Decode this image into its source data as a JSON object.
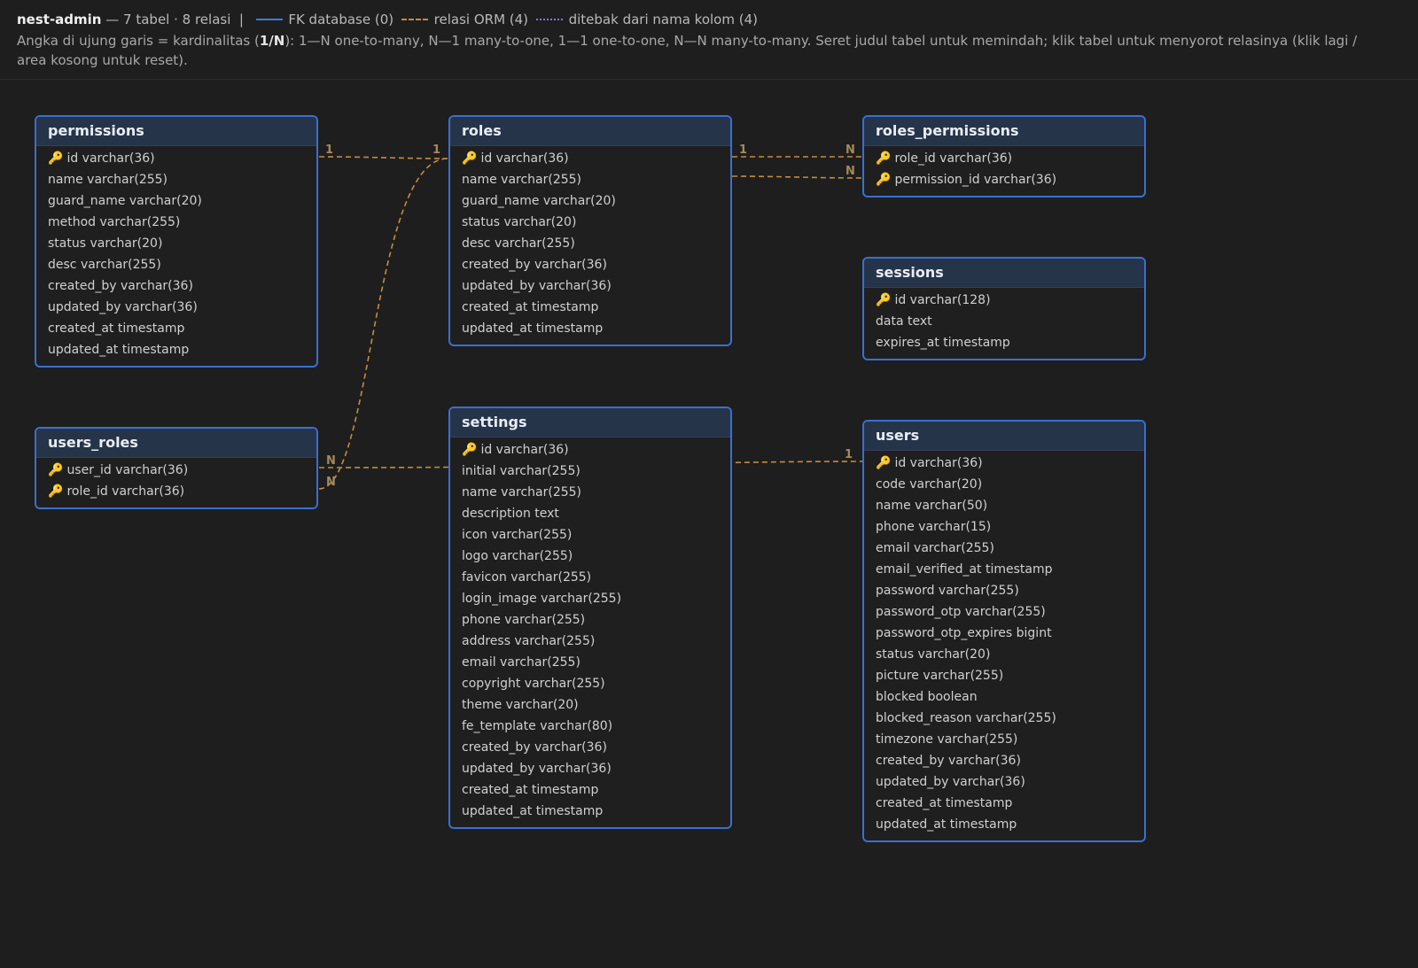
{
  "header": {
    "app_name": "nest-admin",
    "summary": " — 7 tabel · 8 relasi",
    "separator": "|",
    "legend": {
      "fk_label": "FK database (0)",
      "orm_label": "relasi ORM (4)",
      "guess_label": "ditebak dari nama kolom (4)"
    },
    "help_prefix": "Angka di ujung garis = kardinalitas (",
    "help_bold": "1/N",
    "help_suffix": "): 1—N one-to-many, N—1 many-to-one, 1—1 one-to-one, N—N many-to-many. Seret judul tabel untuk memindah; klik tabel untuk menyorot relasinya (klik lagi / area kosong untuk reset)."
  },
  "colors": {
    "background": "#1e1e1e",
    "table_border": "#3a6fd0",
    "table_header": "#263449",
    "fk_line": "#3b7be0",
    "orm_line": "#c78b3e",
    "guess_line": "#8a73e8",
    "key_icon": "#f2b51d"
  },
  "key_icon": "key-icon",
  "tables": [
    {
      "name": "permissions",
      "columns": [
        {
          "text": "id varchar(36)",
          "pk": true
        },
        {
          "text": "name varchar(255)"
        },
        {
          "text": "guard_name varchar(20)"
        },
        {
          "text": "method varchar(255)"
        },
        {
          "text": "status varchar(20)"
        },
        {
          "text": "desc varchar(255)"
        },
        {
          "text": "created_by varchar(36)"
        },
        {
          "text": "updated_by varchar(36)"
        },
        {
          "text": "created_at timestamp"
        },
        {
          "text": "updated_at timestamp"
        }
      ]
    },
    {
      "name": "roles",
      "columns": [
        {
          "text": "id varchar(36)",
          "pk": true
        },
        {
          "text": "name varchar(255)"
        },
        {
          "text": "guard_name varchar(20)"
        },
        {
          "text": "status varchar(20)"
        },
        {
          "text": "desc varchar(255)"
        },
        {
          "text": "created_by varchar(36)"
        },
        {
          "text": "updated_by varchar(36)"
        },
        {
          "text": "created_at timestamp"
        },
        {
          "text": "updated_at timestamp"
        }
      ]
    },
    {
      "name": "roles_permissions",
      "columns": [
        {
          "text": "role_id varchar(36)",
          "pk": true
        },
        {
          "text": "permission_id varchar(36)",
          "pk": true
        }
      ]
    },
    {
      "name": "sessions",
      "columns": [
        {
          "text": "id varchar(128)",
          "pk": true
        },
        {
          "text": "data text"
        },
        {
          "text": "expires_at timestamp"
        }
      ]
    },
    {
      "name": "users_roles",
      "columns": [
        {
          "text": "user_id varchar(36)",
          "pk": true
        },
        {
          "text": "role_id varchar(36)",
          "pk": true
        }
      ]
    },
    {
      "name": "settings",
      "columns": [
        {
          "text": "id varchar(36)",
          "pk": true
        },
        {
          "text": "initial varchar(255)"
        },
        {
          "text": "name varchar(255)"
        },
        {
          "text": "description text"
        },
        {
          "text": "icon varchar(255)"
        },
        {
          "text": "logo varchar(255)"
        },
        {
          "text": "favicon varchar(255)"
        },
        {
          "text": "login_image varchar(255)"
        },
        {
          "text": "phone varchar(255)"
        },
        {
          "text": "address varchar(255)"
        },
        {
          "text": "email varchar(255)"
        },
        {
          "text": "copyright varchar(255)"
        },
        {
          "text": "theme varchar(20)"
        },
        {
          "text": "fe_template varchar(80)"
        },
        {
          "text": "created_by varchar(36)"
        },
        {
          "text": "updated_by varchar(36)"
        },
        {
          "text": "created_at timestamp"
        },
        {
          "text": "updated_at timestamp"
        }
      ]
    },
    {
      "name": "users",
      "columns": [
        {
          "text": "id varchar(36)",
          "pk": true
        },
        {
          "text": "code varchar(20)"
        },
        {
          "text": "name varchar(50)"
        },
        {
          "text": "phone varchar(15)"
        },
        {
          "text": "email varchar(255)"
        },
        {
          "text": "email_verified_at timestamp"
        },
        {
          "text": "password varchar(255)"
        },
        {
          "text": "password_otp varchar(255)"
        },
        {
          "text": "password_otp_expires bigint"
        },
        {
          "text": "status varchar(20)"
        },
        {
          "text": "picture varchar(255)"
        },
        {
          "text": "blocked boolean"
        },
        {
          "text": "blocked_reason varchar(255)"
        },
        {
          "text": "timezone varchar(255)"
        },
        {
          "text": "created_by varchar(36)"
        },
        {
          "text": "updated_by varchar(36)"
        },
        {
          "text": "created_at timestamp"
        },
        {
          "text": "updated_at timestamp"
        }
      ]
    }
  ],
  "relations": [
    {
      "from": "permissions",
      "to": "roles",
      "from_card": "1",
      "to_card": "1"
    },
    {
      "from": "roles",
      "to": "roles_permissions",
      "from_card": "1",
      "to_card": "N"
    },
    {
      "from": "roles",
      "to": "roles_permissions",
      "from_card": "",
      "to_card": "N"
    },
    {
      "from": "users_roles",
      "to": "roles",
      "from_card": "N",
      "to_card": ""
    },
    {
      "from": "users_roles",
      "to": "users",
      "from_card": "N",
      "to_card": "1"
    }
  ]
}
